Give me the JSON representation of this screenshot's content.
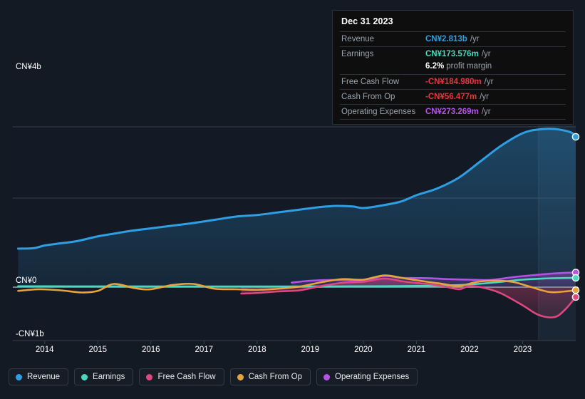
{
  "tooltip": {
    "title": "Dec 31 2023",
    "rows": [
      {
        "label": "Revenue",
        "value": "CN¥2.813b",
        "unit": "/yr",
        "color": "#2f9ee3"
      },
      {
        "label": "Earnings",
        "value": "CN¥173.576m",
        "unit": "/yr",
        "color": "#4ad9c0"
      },
      {
        "label": "",
        "value": "6.2%",
        "unit": "profit margin",
        "color": "#ffffff",
        "sub": true
      },
      {
        "label": "Free Cash Flow",
        "value": "-CN¥184.980m",
        "unit": "/yr",
        "color": "#e8343f"
      },
      {
        "label": "Cash From Op",
        "value": "-CN¥56.477m",
        "unit": "/yr",
        "color": "#e8343f"
      },
      {
        "label": "Operating Expenses",
        "value": "CN¥273.269m",
        "unit": "/yr",
        "color": "#b552e8"
      }
    ]
  },
  "legend": [
    {
      "label": "Revenue",
      "color": "#2f9ee3"
    },
    {
      "label": "Earnings",
      "color": "#4ad9c0"
    },
    {
      "label": "Free Cash Flow",
      "color": "#e0477f"
    },
    {
      "label": "Cash From Op",
      "color": "#e8a33d"
    },
    {
      "label": "Operating Expenses",
      "color": "#b552e8"
    }
  ],
  "chart_data": {
    "type": "area",
    "title": "",
    "xlabel": "",
    "ylabel": "",
    "currency": "CN¥",
    "grid": true,
    "legend_position": "bottom",
    "ylim": [
      -1000000000,
      4500000000
    ],
    "y_ticks": [
      {
        "value": 4000000000,
        "label": "CN¥4b"
      },
      {
        "value": 0,
        "label": "CN¥0"
      },
      {
        "value": -1000000000,
        "label": "-CN¥1b"
      }
    ],
    "x_ticks": [
      "2014",
      "2015",
      "2016",
      "2017",
      "2018",
      "2019",
      "2020",
      "2021",
      "2022",
      "2023"
    ],
    "x_range": [
      "2013.4",
      "2024.0"
    ],
    "forecast_start": "2023.3",
    "series": [
      {
        "name": "Revenue",
        "color": "#2f9ee3",
        "fill": true,
        "x": [
          2013.5,
          2013.8,
          2014.0,
          2014.3,
          2014.6,
          2015.0,
          2015.3,
          2015.6,
          2016.0,
          2016.4,
          2016.8,
          2017.2,
          2017.6,
          2018.0,
          2018.4,
          2018.8,
          2019.2,
          2019.5,
          2019.8,
          2020.0,
          2020.3,
          2020.7,
          2021.0,
          2021.4,
          2021.8,
          2022.2,
          2022.6,
          2023.0,
          2023.3,
          2023.6,
          2023.9,
          2024.0
        ],
        "values": [
          0.72,
          0.73,
          0.78,
          0.82,
          0.86,
          0.95,
          1.0,
          1.05,
          1.1,
          1.15,
          1.2,
          1.26,
          1.32,
          1.35,
          1.4,
          1.45,
          1.5,
          1.52,
          1.51,
          1.48,
          1.52,
          1.6,
          1.72,
          1.85,
          2.05,
          2.35,
          2.65,
          2.88,
          2.95,
          2.96,
          2.9,
          2.813
        ],
        "unit": "b"
      },
      {
        "name": "Earnings",
        "color": "#4ad9c0",
        "fill": false,
        "x": [
          2013.5,
          2014.5,
          2015.5,
          2016.5,
          2017.5,
          2018.5,
          2019.5,
          2020.5,
          2021.0,
          2021.5,
          2022.0,
          2022.5,
          2023.0,
          2023.5,
          2024.0
        ],
        "values": [
          0.016,
          0.015,
          0.014,
          0.012,
          0.012,
          0.013,
          0.015,
          0.018,
          0.022,
          0.03,
          0.05,
          0.09,
          0.14,
          0.165,
          0.1736
        ],
        "unit": "b"
      },
      {
        "name": "Free Cash Flow",
        "color": "#e0477f",
        "fill": true,
        "start_x": 2017.7,
        "x": [
          2017.7,
          2018.0,
          2018.4,
          2018.8,
          2019.2,
          2019.6,
          2020.0,
          2020.4,
          2020.8,
          2021.2,
          2021.5,
          2021.8,
          2022.0,
          2022.3,
          2022.6,
          2023.0,
          2023.3,
          2023.6,
          2023.8,
          2024.0
        ],
        "values": [
          -0.12,
          -0.11,
          -0.08,
          -0.06,
          0.02,
          0.08,
          0.1,
          0.16,
          0.1,
          0.06,
          0.02,
          -0.04,
          0.02,
          -0.02,
          -0.12,
          -0.34,
          -0.52,
          -0.56,
          -0.42,
          -0.18498
        ],
        "unit": "b"
      },
      {
        "name": "Cash From Op",
        "color": "#e8a33d",
        "fill": false,
        "x": [
          2013.5,
          2013.9,
          2014.3,
          2014.7,
          2015.0,
          2015.3,
          2015.7,
          2016.0,
          2016.4,
          2016.8,
          2017.2,
          2017.6,
          2018.0,
          2018.4,
          2018.8,
          2019.2,
          2019.6,
          2020.0,
          2020.4,
          2020.8,
          2021.2,
          2021.5,
          2021.8,
          2022.1,
          2022.4,
          2022.8,
          2023.1,
          2023.5,
          2023.8,
          2024.0
        ],
        "values": [
          -0.07,
          -0.04,
          -0.06,
          -0.1,
          -0.07,
          0.06,
          -0.02,
          -0.04,
          0.04,
          0.06,
          -0.03,
          -0.04,
          -0.05,
          -0.03,
          0.01,
          0.09,
          0.15,
          0.14,
          0.22,
          0.16,
          0.1,
          0.06,
          0.02,
          0.09,
          0.12,
          0.1,
          0.02,
          -0.09,
          -0.08,
          -0.056477
        ],
        "unit": "b"
      },
      {
        "name": "Operating Expenses",
        "color": "#b552e8",
        "fill": true,
        "start_x": 2018.65,
        "x": [
          2018.65,
          2019.0,
          2019.4,
          2019.8,
          2020.1,
          2020.4,
          2020.7,
          2021.0,
          2021.3,
          2021.6,
          2022.0,
          2022.4,
          2022.8,
          2023.1,
          2023.5,
          2023.8,
          2024.0
        ],
        "values": [
          0.085,
          0.12,
          0.135,
          0.125,
          0.145,
          0.21,
          0.175,
          0.17,
          0.165,
          0.15,
          0.14,
          0.135,
          0.185,
          0.215,
          0.25,
          0.268,
          0.273269
        ],
        "unit": "b"
      }
    ]
  },
  "geometry": {
    "plot_left": 18,
    "plot_right": 808,
    "plot_top": 176,
    "plot_bottom": 478,
    "zero_y": 403,
    "y_per_b": 75,
    "gridlines_y": [
      178,
      278
    ]
  }
}
